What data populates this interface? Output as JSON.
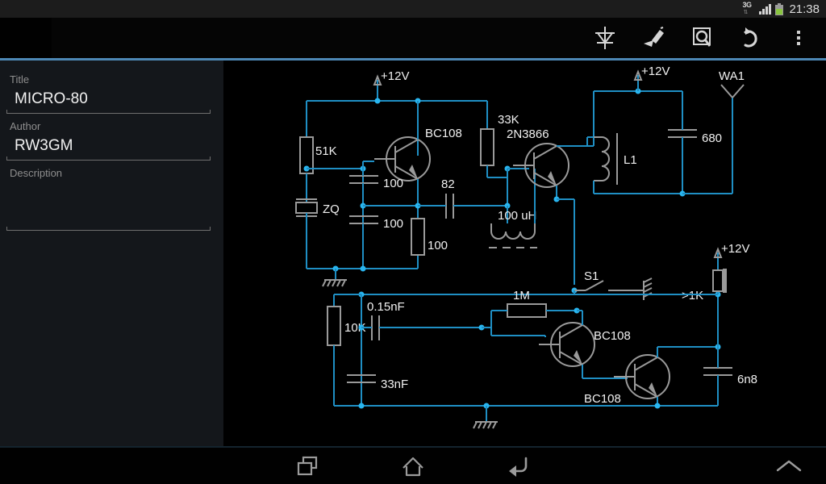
{
  "statusbar": {
    "network_label": "3G",
    "network_arrows": "⇅",
    "clock": "21:38",
    "signal_icon": "signal-bars-icon",
    "battery_icon": "battery-icon"
  },
  "actionbar": {
    "buttons": [
      {
        "name": "add-component-button",
        "icon": "component-symbol-icon"
      },
      {
        "name": "draw-wire-button",
        "icon": "pen-icon"
      },
      {
        "name": "zoom-fit-button",
        "icon": "magnifier-in-frame-icon"
      },
      {
        "name": "undo-button",
        "icon": "undo-arrow-icon"
      },
      {
        "name": "overflow-menu-button",
        "icon": "three-dots-icon"
      }
    ],
    "accent_color": "#4d88b5"
  },
  "sidebar": {
    "fields": [
      {
        "label": "Title",
        "value": "MICRO-80"
      },
      {
        "label": "Author",
        "value": "RW3GM"
      },
      {
        "label": "Description",
        "value": ""
      }
    ]
  },
  "navbar": {
    "buttons": [
      {
        "name": "nav-recent-apps-button",
        "icon": "recent-apps-icon"
      },
      {
        "name": "nav-home-button",
        "icon": "home-icon"
      },
      {
        "name": "nav-back-button",
        "icon": "back-arrow-icon"
      },
      {
        "name": "nav-expand-button",
        "icon": "chevron-up-icon"
      }
    ]
  },
  "schematic": {
    "title": "MICRO-80",
    "wire_color": "#1f8fc4",
    "junction_color": "#29b6f0",
    "component_color": "#9a9a9a",
    "label_color": "#f0f0f0",
    "labels": [
      {
        "id": "supply-1",
        "text": "+12V"
      },
      {
        "id": "r-51k",
        "text": "51K"
      },
      {
        "id": "q-bc108-osc",
        "text": "BC108"
      },
      {
        "id": "r-33k",
        "text": "33K"
      },
      {
        "id": "q-2n3866",
        "text": "2N3866"
      },
      {
        "id": "supply-2",
        "text": "+12V"
      },
      {
        "id": "antenna-wa1",
        "text": "WA1"
      },
      {
        "id": "l1-coil",
        "text": "L1"
      },
      {
        "id": "c-680",
        "text": "680"
      },
      {
        "id": "c-100-top",
        "text": "100"
      },
      {
        "id": "c-100-bottom",
        "text": "100"
      },
      {
        "id": "xtal-zq",
        "text": "ZQ"
      },
      {
        "id": "c-82",
        "text": "82"
      },
      {
        "id": "r-100",
        "text": "100"
      },
      {
        "id": "l-100uh",
        "text": "100 uH"
      },
      {
        "id": "switch-s1",
        "text": "S1"
      },
      {
        "id": "supply-3",
        "text": "+12V"
      },
      {
        "id": "speaker-1k",
        "text": ">1K"
      },
      {
        "id": "r-10k",
        "text": "10K"
      },
      {
        "id": "c-015nf",
        "text": "0.15nF"
      },
      {
        "id": "r-1m",
        "text": "1M"
      },
      {
        "id": "q-bc108-a",
        "text": "BC108"
      },
      {
        "id": "c-33nf",
        "text": "33nF"
      },
      {
        "id": "q-bc108-b",
        "text": "BC108"
      },
      {
        "id": "c-6n8",
        "text": "6n8"
      }
    ]
  }
}
